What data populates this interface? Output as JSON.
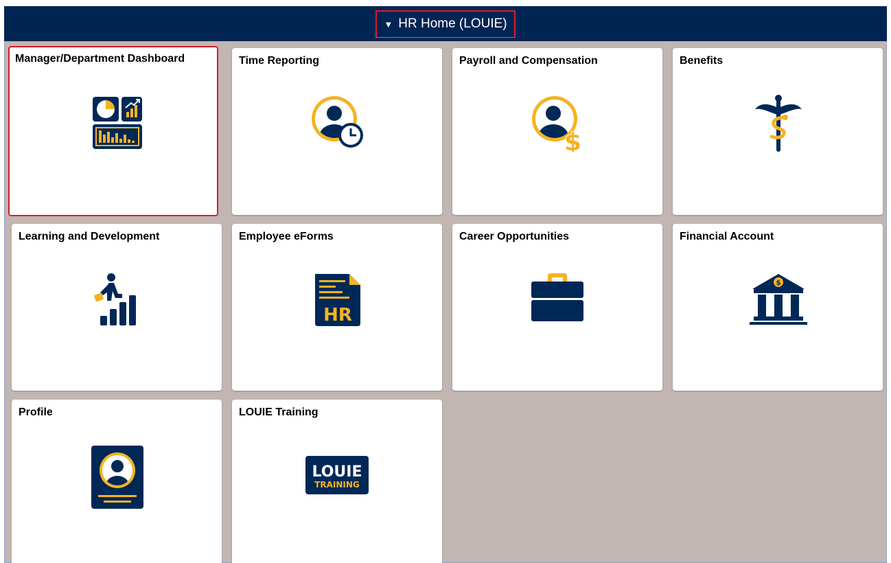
{
  "header": {
    "title": "HR Home (LOUIE)"
  },
  "tiles": [
    {
      "label": "Manager/Department Dashboard"
    },
    {
      "label": "Time Reporting"
    },
    {
      "label": "Payroll and Compensation"
    },
    {
      "label": "Benefits"
    },
    {
      "label": "Learning and Development"
    },
    {
      "label": "Employee eForms"
    },
    {
      "label": "Career Opportunities"
    },
    {
      "label": "Financial Account"
    },
    {
      "label": "Profile"
    },
    {
      "label": "LOUIE Training"
    }
  ],
  "icons": {
    "eforms_text": "HR",
    "training_line1": "LOUIE",
    "training_line2": "TRAINING"
  },
  "colors": {
    "navy": "#002856",
    "gold": "#f5b323",
    "header_bg": "#012553",
    "page_bg": "#c2b6b2",
    "focus_border": "#d31f2e"
  }
}
